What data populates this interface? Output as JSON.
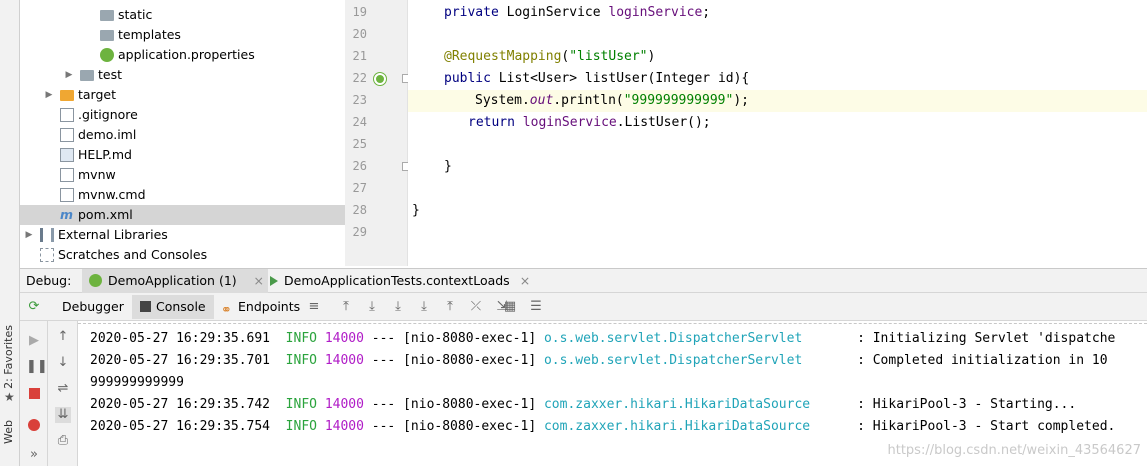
{
  "left_strip": {
    "favorites_label": "2: Favorites",
    "web_label": "Web"
  },
  "tree": [
    {
      "label": "static",
      "depth": 3,
      "icon": "folder-icon",
      "selected": false,
      "arrow": ""
    },
    {
      "label": "templates",
      "depth": 3,
      "icon": "folder-icon",
      "selected": false,
      "arrow": ""
    },
    {
      "label": "application.properties",
      "depth": 3,
      "icon": "spring-properties-icon",
      "selected": false,
      "arrow": ""
    },
    {
      "label": "test",
      "depth": 2,
      "icon": "folder-icon",
      "selected": false,
      "arrow": "▶"
    },
    {
      "label": "target",
      "depth": 1,
      "icon": "folder-orange-icon",
      "selected": false,
      "arrow": "▶"
    },
    {
      "label": ".gitignore",
      "depth": 1,
      "icon": "file-icon",
      "selected": false,
      "arrow": ""
    },
    {
      "label": "demo.iml",
      "depth": 1,
      "icon": "iml-file-icon",
      "selected": false,
      "arrow": ""
    },
    {
      "label": "HELP.md",
      "depth": 1,
      "icon": "markdown-file-icon",
      "selected": false,
      "arrow": ""
    },
    {
      "label": "mvnw",
      "depth": 1,
      "icon": "shell-file-icon",
      "selected": false,
      "arrow": ""
    },
    {
      "label": "mvnw.cmd",
      "depth": 1,
      "icon": "cmd-file-icon",
      "selected": false,
      "arrow": ""
    },
    {
      "label": "pom.xml",
      "depth": 1,
      "icon": "maven-pom-icon",
      "selected": true,
      "arrow": ""
    },
    {
      "label": "External Libraries",
      "depth": 0,
      "icon": "library-icon",
      "selected": false,
      "arrow": "▶"
    },
    {
      "label": "Scratches and Consoles",
      "depth": 0,
      "icon": "scratches-icon",
      "selected": false,
      "arrow": ""
    }
  ],
  "gutter": {
    "line_numbers": [
      "19",
      "20",
      "21",
      "22",
      "23",
      "24",
      "25",
      "26",
      "27",
      "28",
      "29"
    ]
  },
  "code": {
    "l19": {
      "kw": "private ",
      "type": "LoginService ",
      "field": "loginService",
      "end": ";"
    },
    "l21": {
      "annotation": "@RequestMapping",
      "open": "(",
      "str": "\"listUser\"",
      "close": ")"
    },
    "l22": {
      "kw": "public ",
      "text": "List<User> listUser(Integer id){"
    },
    "l23": {
      "text1": "System.",
      "italic": "out",
      "text2": ".println(",
      "str": "\"999999999999\"",
      "text3": ");"
    },
    "l24": {
      "kw": "return ",
      "field": "loginService",
      "text": ".ListUser();"
    },
    "l26": {
      "text": "}"
    },
    "l28": {
      "text": "}"
    }
  },
  "debug_bar": {
    "label": "Debug:",
    "tabs": [
      {
        "label": "DemoApplication (1)",
        "active": true
      },
      {
        "label": "DemoApplicationTests.contextLoads",
        "active": false
      }
    ],
    "close_glyph": "×"
  },
  "debug_toolbar": {
    "tabs": [
      {
        "label": "Debugger",
        "icon": "",
        "active": false
      },
      {
        "label": "Console",
        "icon": "console-icon",
        "active": true
      },
      {
        "label": "Endpoints",
        "icon": "endpoints-icon",
        "active": false
      }
    ]
  },
  "console": {
    "lines": [
      {
        "ts": "2020-05-27 16:29:35.691",
        "level": "INFO",
        "pid": "14000",
        "sep": " --- ",
        "thread": "[nio-8080-exec-1]",
        "logger": "o.s.web.servlet.DispatcherServlet",
        "msg": ": Initializing Servlet 'dispatche"
      },
      {
        "ts": "2020-05-27 16:29:35.701",
        "level": "INFO",
        "pid": "14000",
        "sep": " --- ",
        "thread": "[nio-8080-exec-1]",
        "logger": "o.s.web.servlet.DispatcherServlet",
        "msg": ": Completed initialization in 10 "
      },
      {
        "plain": "999999999999"
      },
      {
        "ts": "2020-05-27 16:29:35.742",
        "level": "INFO",
        "pid": "14000",
        "sep": " --- ",
        "thread": "[nio-8080-exec-1]",
        "logger": "com.zaxxer.hikari.HikariDataSource",
        "msg": ": HikariPool-3 - Starting..."
      },
      {
        "ts": "2020-05-27 16:29:35.754",
        "level": "INFO",
        "pid": "14000",
        "sep": " --- ",
        "thread": "[nio-8080-exec-1]",
        "logger": "com.zaxxer.hikari.HikariDataSource",
        "msg": ": HikariPool-3 - Start completed."
      }
    ],
    "watermark": "https://blog.csdn.net/weixin_43564627"
  },
  "colors": {
    "info": "#2aa33c",
    "pid": "#b01cc7",
    "logger": "#20a4b8",
    "selected_row": "#d5d5d5",
    "target_folder": "#f0a732"
  }
}
